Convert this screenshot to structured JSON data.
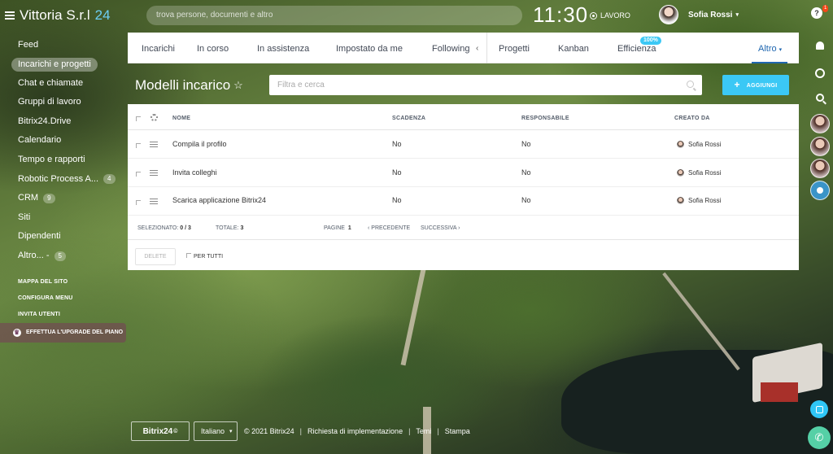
{
  "app": {
    "name": "Vittoria S.r.l",
    "num": "24"
  },
  "topbar": {
    "search_placeholder": "trova persone, documenti e altro",
    "clock": "11:30",
    "status": "LAVORO",
    "user_name": "Sofia Rossi"
  },
  "leftmenu": {
    "items": [
      {
        "label": "Feed"
      },
      {
        "label": "Incarichi e progetti",
        "active": true
      },
      {
        "label": "Chat e chiamate"
      },
      {
        "label": "Gruppi di lavoro"
      },
      {
        "label": "Bitrix24.Drive"
      },
      {
        "label": "Calendario"
      },
      {
        "label": "Tempo e rapporti"
      },
      {
        "label": "Robotic Process A...",
        "badge": "4"
      },
      {
        "label": "CRM",
        "badge": "9"
      },
      {
        "label": "Siti"
      },
      {
        "label": "Dipendenti"
      },
      {
        "label": "Altro... -",
        "badge": "5"
      }
    ],
    "links": [
      "MAPPA DEL SITO",
      "CONFIGURA MENU",
      "INVITA UTENTI"
    ],
    "upgrade": "EFFETTUA L'UPGRADE DEL PIANO"
  },
  "tabs": {
    "items": [
      "Incarichi",
      "In corso",
      "In assistenza",
      "Impostato da me",
      "Following",
      "Progetti",
      "Kanban",
      "Efficienza",
      "Altro"
    ],
    "efficiency_badge": "100%"
  },
  "page": {
    "title": "Modelli incarico",
    "filter_placeholder": "Filtra e cerca",
    "add_button": "AGGIUNGI"
  },
  "grid": {
    "columns": [
      "NOME",
      "SCADENZA",
      "RESPONSABILE",
      "CREATO DA"
    ],
    "rows": [
      {
        "name": "Compila il profilo",
        "deadline": "No",
        "responsible": "No",
        "creator": "Sofia Rossi"
      },
      {
        "name": "Invita colleghi",
        "deadline": "No",
        "responsible": "No",
        "creator": "Sofia Rossi"
      },
      {
        "name": "Scarica applicazione Bitrix24",
        "deadline": "No",
        "responsible": "No",
        "creator": "Sofia Rossi"
      }
    ],
    "footer": {
      "selected_label": "SELEZIONATO:",
      "selected_value": "0 / 3",
      "total_label": "TOTALE:",
      "total_value": "3",
      "pages_label": "PAGINE",
      "pages_value": "1",
      "prev": "PRECEDENTE",
      "next": "SUCCESSIVA"
    },
    "delete_button": "DELETE",
    "for_all": "PER TUTTI"
  },
  "rightbar": {
    "notif_count": "1"
  },
  "footer": {
    "logo": "Bitrix24",
    "language": "Italiano",
    "copyright": "© 2021 Bitrix24",
    "links": [
      "Richiesta di implementazione",
      "Temi",
      "Stampa"
    ]
  }
}
